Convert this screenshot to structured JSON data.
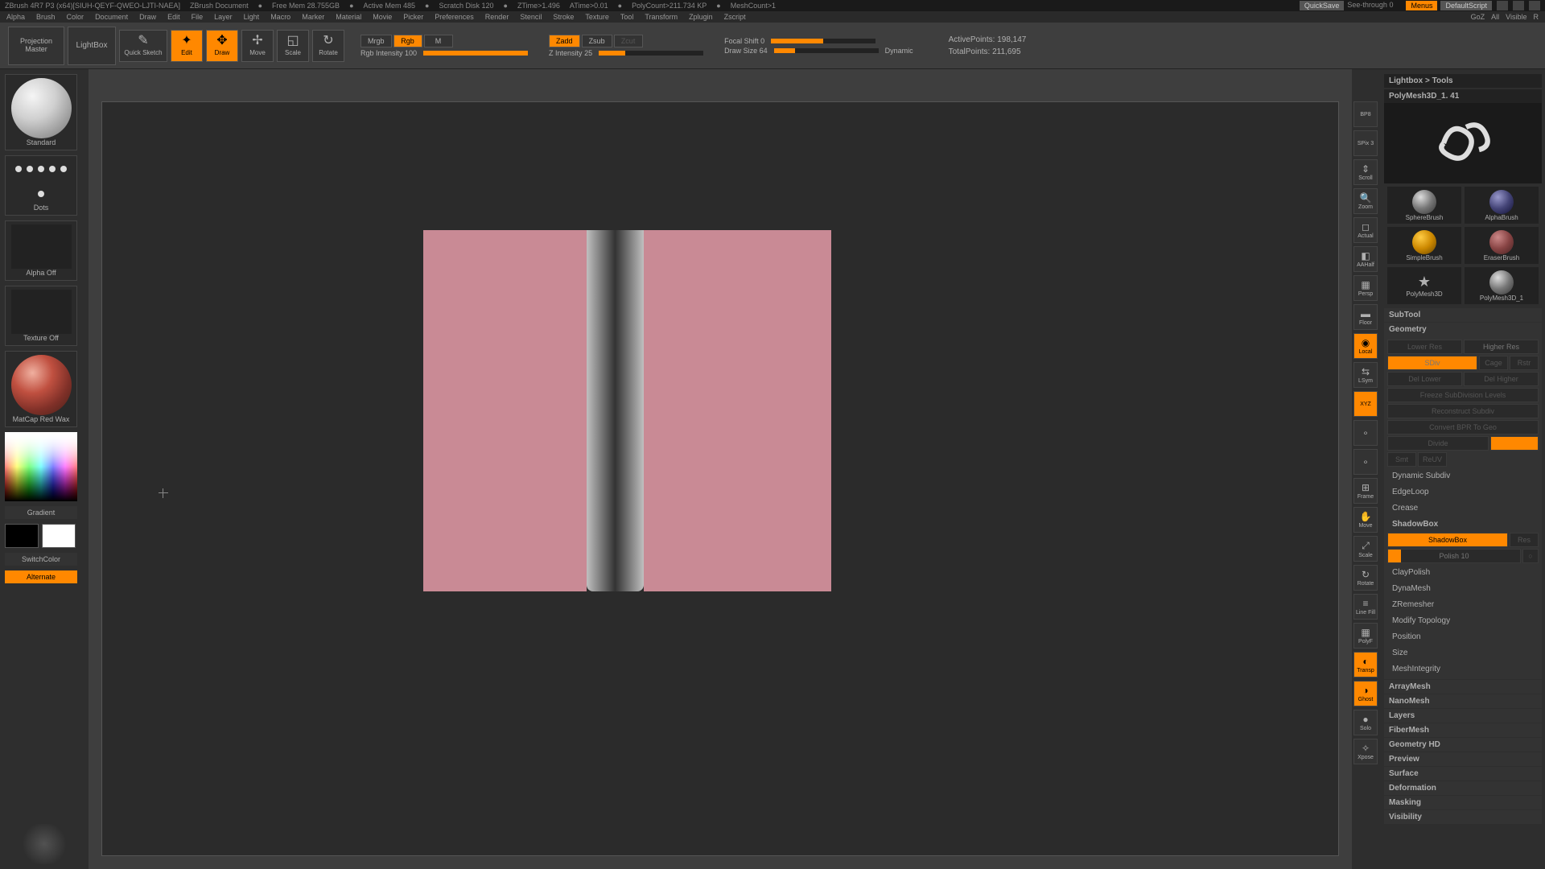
{
  "titlebar": {
    "app": "ZBrush 4R7 P3 (x64)[SIUH-QEYF-QWEO-LJTI-NAEA]",
    "doc": "ZBrush Document",
    "freemem": "Free Mem 28.755GB",
    "activemem": "Active Mem 485",
    "scratch": "Scratch Disk 120",
    "ztime": "ZTime>1.496",
    "atime": "ATime>0.01",
    "polycount": "PolyCount>211.734 KP",
    "meshcount": "MeshCount>1",
    "quicksave": "QuickSave",
    "seethrough": "See-through   0",
    "menus": "Menus",
    "script": "DefaultScript"
  },
  "menus": [
    "Alpha",
    "Brush",
    "Color",
    "Document",
    "Draw",
    "Edit",
    "File",
    "Layer",
    "Light",
    "Macro",
    "Marker",
    "Material",
    "Movie",
    "Picker",
    "Preferences",
    "Render",
    "Stencil",
    "Stroke",
    "Texture",
    "Tool",
    "Transform",
    "Zplugin",
    "Zscript"
  ],
  "menus_right": {
    "goz": "GoZ",
    "all": "All",
    "visible": "Visible",
    "r": "R"
  },
  "shelf": {
    "proj1": "Projection",
    "proj2": "Master",
    "lightbox": "LightBox",
    "qsketch": "Quick Sketch",
    "edit": "Edit",
    "draw": "Draw",
    "move": "Move",
    "scale": "Scale",
    "rotate": "Rotate",
    "mrgb": "Mrgb",
    "rgb": "Rgb",
    "m": "M",
    "rgbint": "Rgb Intensity 100",
    "zadd": "Zadd",
    "zsub": "Zsub",
    "zcut": "Zcut",
    "zint": "Z Intensity 25",
    "focal": "Focal Shift 0",
    "drawsize": "Draw Size 64",
    "dynamic": "Dynamic",
    "active": "ActivePoints: 198,147",
    "total": "TotalPoints: 211,695"
  },
  "ltray": {
    "brush": "Standard",
    "stroke": "Dots",
    "alpha": "Alpha Off",
    "texture": "Texture Off",
    "material": "MatCap Red Wax",
    "gradient": "Gradient",
    "switch": "SwitchColor",
    "alternate": "Alternate"
  },
  "rnav": [
    "BP8",
    "SPix 3",
    "Scroll",
    "Zoom",
    "Actual",
    "AAHalf",
    "Persp",
    "Floor",
    "Local",
    "LSym",
    "XYZ",
    "",
    "",
    "Frame",
    "Move",
    "Scale",
    "Rotate",
    "Line Fill",
    "PolyF",
    "Transp",
    "Ghost",
    "Solo",
    "Xpose"
  ],
  "rtray": {
    "lightbox": "Lightbox > Tools",
    "tool_title": "PolyMesh3D_1. 41",
    "tools": [
      "SphereBrush",
      "AlphaBrush",
      "SimpleBrush",
      "EraserBrush",
      "PolyMesh3D",
      "PolyMesh3D_1"
    ],
    "subtool": "SubTool",
    "geometry": "Geometry",
    "geo": {
      "lowres": "Lower Res",
      "hires": "Higher Res",
      "sdiv": "SDiv",
      "cage": "Cage",
      "rstr": "Rstr",
      "dellow": "Del Lower",
      "delhigh": "Del Higher",
      "freeze": "Freeze SubDivision Levels",
      "recon": "Reconstruct Subdiv",
      "convert": "Convert BPR To Geo",
      "divide": "Divide",
      "smt": "Smt",
      "suv": "ReUV",
      "dynsub": "Dynamic Subdiv",
      "edgeloop": "EdgeLoop",
      "crease": "Crease",
      "shadowbox_hdr": "ShadowBox",
      "shadowbox": "ShadowBox",
      "res": "Res",
      "polish": "Polish 10",
      "claypolish": "ClayPolish",
      "dynamesh": "DynaMesh",
      "zremesh": "ZRemesher",
      "modtopo": "Modify Topology",
      "position": "Position",
      "size": "Size",
      "meshint": "MeshIntegrity"
    },
    "sections": [
      "ArrayMesh",
      "NanoMesh",
      "Layers",
      "FiberMesh",
      "Geometry HD",
      "Preview",
      "Surface",
      "Deformation",
      "Masking",
      "Visibility"
    ]
  }
}
